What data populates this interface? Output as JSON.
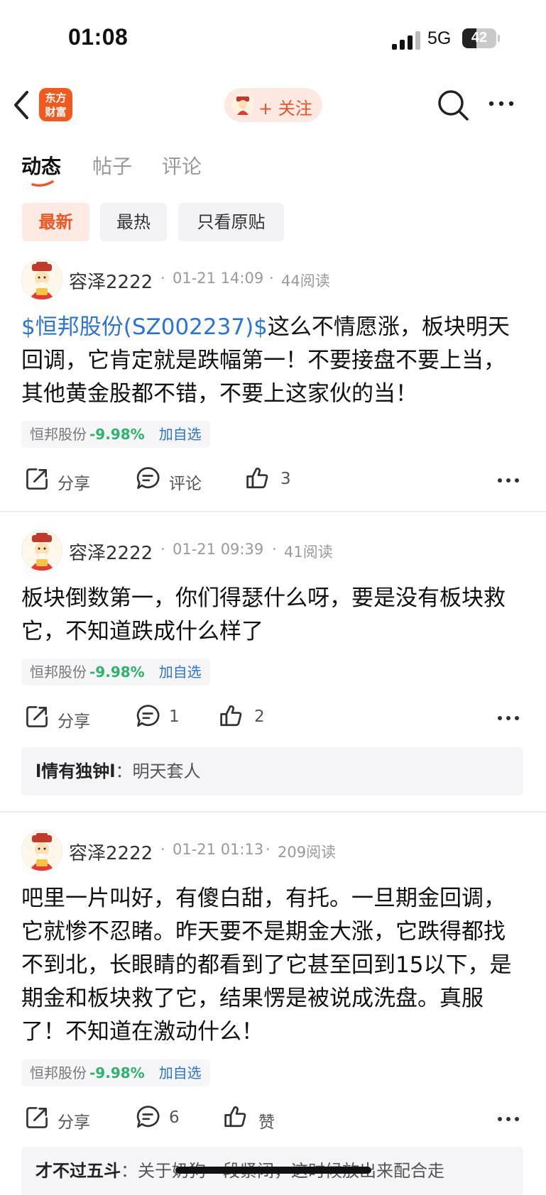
{
  "status_bar": {
    "time": "01:08",
    "network": "5G",
    "battery": "42",
    "battery_level": 0.42
  },
  "nav": {
    "logo_line1": "东方",
    "logo_line2": "财富",
    "follow_label": "+ 关注"
  },
  "tabs": [
    "动态",
    "帖子",
    "评论"
  ],
  "filters": [
    "最新",
    "最热",
    "只看原贴"
  ],
  "posts": [
    {
      "username": "容泽2222",
      "sep1": "·",
      "time": "01-21 14:09",
      "sep2": "·",
      "reads": "44阅读",
      "tag": "$恒邦股份(SZ002237)$",
      "text": "这么不情愿涨，板块明天回调，它肯定就是跌幅第一！不要接盘不要上当，其他黄金股都不错，不要上这家伙的当！",
      "stock_name": "恒邦股份",
      "stock_change": "-9.98%",
      "add_label": "加自选",
      "share": "分享",
      "comment": "评论",
      "like": "3"
    },
    {
      "username": "容泽2222",
      "sep1": "·",
      "time": "01-21 09:39",
      "sep2": "·",
      "reads": "41阅读",
      "text": "板块倒数第一，你们得瑟什么呀，要是没有板块救它，不知道跌成什么样了",
      "stock_name": "恒邦股份",
      "stock_change": "-9.98%",
      "add_label": "加自选",
      "share": "分享",
      "comment": "1",
      "like": "2",
      "reply_name": "l情有独钟l",
      "reply_colon": "：",
      "reply_text": "明天套人"
    },
    {
      "username": "容泽2222",
      "sep1": "·",
      "time": "01-21 01:13",
      "sep2": "·",
      "reads": "209阅读",
      "text": "吧里一片叫好，有傻白甜，有托。一旦期金回调，它就惨不忍睹。昨天要不是期金大涨，它跌得都找不到北，长眼睛的都看到了它甚至回到15以下，是期金和板块救了它，结果愣是被说成洗盘。真服了！不知道在激动什么！",
      "stock_name": "恒邦股份",
      "stock_change": "-9.98%",
      "add_label": "加自选",
      "share": "分享",
      "comment": "6",
      "like": "赞",
      "reply_name": "才不过五斗",
      "reply_colon": "：",
      "reply_text": "关于奶狗一段紧闭，这时候放出来配合走"
    }
  ],
  "colors": {
    "accent": "#ee5623",
    "link": "#2b74d6",
    "down": "#2db36b"
  }
}
